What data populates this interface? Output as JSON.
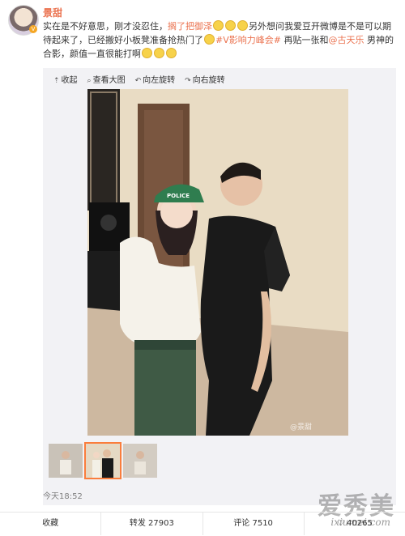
{
  "post": {
    "username": "景甜",
    "verified_badge": "V",
    "text_part1": "实在是不好意思，刚才没忍住，",
    "highlight": "搁了把",
    "highlight2": "御泽",
    "text_part2": "另外想问我爱豆开微博是不是可以期待起来了，已经搬好小板凳准备抢热门了",
    "hashtag": "#V影响力峰会#",
    "text_part3": " 再贴一张和",
    "mention": "@古天乐",
    "text_part4": " 男神的合影，颜值一直很能打啊",
    "timestamp": "今天18:52"
  },
  "toolbar": {
    "collapse": "收起",
    "view_large": "查看大图",
    "rotate_left": "向左旋转",
    "rotate_right": "向右旋转"
  },
  "photo": {
    "cap_text": "POLICE",
    "watermark": "@景甜"
  },
  "actions": {
    "favorite": "收藏",
    "repost": "转发 27903",
    "comment": "评论 7510",
    "like": "40265"
  },
  "site_watermark": {
    "name": "爱秀美",
    "url": "ixiumei.com"
  },
  "icons": [
    "collapse-icon",
    "zoom-icon",
    "rotate-left-icon",
    "rotate-right-icon",
    "like-icon"
  ]
}
